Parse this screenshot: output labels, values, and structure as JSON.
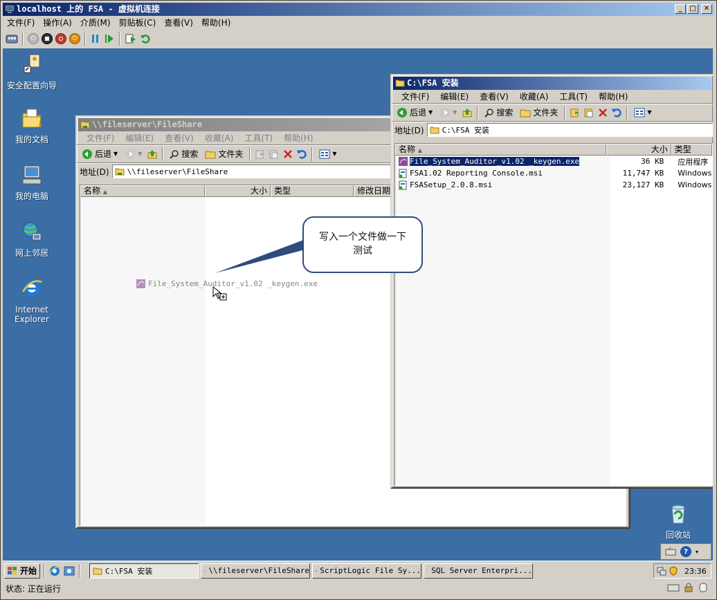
{
  "host": {
    "title": "localhost 上的 FSA - 虚拟机连接",
    "controls": {
      "minimize": "_",
      "maximize": "□",
      "close": "✕"
    },
    "menu": [
      "文件(F)",
      "操作(A)",
      "介质(M)",
      "剪贴板(C)",
      "查看(V)",
      "帮助(H)"
    ],
    "toolbar_icons": [
      "ctrl-alt-del-icon",
      "start-icon",
      "turn-off-icon",
      "shutdown-icon",
      "power-icon",
      "pause-icon",
      "resume-icon",
      "snapshot-icon",
      "revert-icon"
    ]
  },
  "desktop": {
    "icons": [
      {
        "name": "security-config-wizard",
        "label": "安全配置向导"
      },
      {
        "name": "my-documents",
        "label": "我的文档"
      },
      {
        "name": "my-computer",
        "label": "我的电脑"
      },
      {
        "name": "network-places",
        "label": "网上邻居"
      },
      {
        "name": "internet-explorer",
        "label": "Internet Explorer"
      },
      {
        "name": "recycle-bin",
        "label": "回收站"
      }
    ]
  },
  "fileshare_window": {
    "title": "\\\\fileserver\\FileShare",
    "menu": [
      "文件(F)",
      "编辑(E)",
      "查看(V)",
      "收藏(A)",
      "工具(T)",
      "帮助(H)"
    ],
    "toolbar": {
      "back": "后退",
      "search": "搜索",
      "folders": "文件夹"
    },
    "address_label": "地址(D)",
    "address": "\\\\fileserver\\FileShare",
    "columns": [
      "名称",
      "大小",
      "类型",
      "修改日期"
    ],
    "dragging_file": "File_System_Auditor_v1.02 _keygen.exe"
  },
  "fsa_window": {
    "title": "C:\\FSA 安装",
    "menu": [
      "文件(F)",
      "编辑(E)",
      "查看(V)",
      "收藏(A)",
      "工具(T)",
      "帮助(H)"
    ],
    "toolbar": {
      "back": "后退",
      "search": "搜索",
      "folders": "文件夹"
    },
    "address_label": "地址(D)",
    "address": "C:\\FSA 安装",
    "columns": [
      "名称",
      "大小",
      "类型"
    ],
    "files": [
      {
        "name": "File_System_Auditor_v1.02 _keygen.exe",
        "size": "36 KB",
        "type": "应用程序"
      },
      {
        "name": "FSA1.02 Reporting Console.msi",
        "size": "11,747 KB",
        "type": "Windows"
      },
      {
        "name": "FSASetup_2.0.8.msi",
        "size": "23,127 KB",
        "type": "Windows"
      }
    ]
  },
  "callout": {
    "line1": "写入一个文件做一下",
    "line2": "测试"
  },
  "taskbar": {
    "start": "开始",
    "tasks": [
      "C:\\FSA 安装",
      "\\\\fileserver\\FileShare",
      "ScriptLogic File Sy...",
      "SQL Server Enterpri..."
    ],
    "clock": "23:36"
  },
  "status": "状态: 正在运行",
  "colors": {
    "desktop": "#3a6ea5",
    "title_active": "#0a246a",
    "selection": "#0a246a"
  }
}
